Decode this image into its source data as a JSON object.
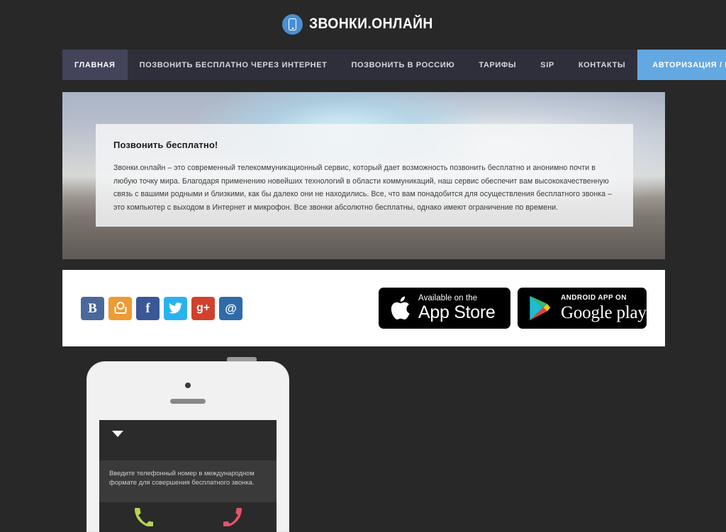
{
  "site": {
    "logo_text": "ЗВОНКИ.ОНЛАЙН",
    "logo_icon": "mobile-phone-icon",
    "accent_blue": "#63a8e0",
    "logo_blue": "#4a8fd1",
    "page_background": "#282828",
    "nav_background": "#2f2f3b",
    "nav_active_background": "#43435a"
  },
  "nav": {
    "items": [
      {
        "label": "ГЛАВНАЯ",
        "active": true
      },
      {
        "label": "ПОЗВОНИТЬ БЕСПЛАТНО ЧЕРЕЗ ИНТЕРНЕТ",
        "active": false
      },
      {
        "label": "ПОЗВОНИТЬ В РОССИЮ",
        "active": false
      },
      {
        "label": "ТАРИФЫ",
        "active": false
      },
      {
        "label": "SIP",
        "active": false
      },
      {
        "label": "КОНТАКТЫ",
        "active": false
      }
    ],
    "cta_label": "АВТОРИЗАЦИЯ / РЕГИСТРАЦИЯ"
  },
  "hero": {
    "title": "Позвонить бесплатно!",
    "body": "Звонки.онлайн – это современный телекоммуникационный сервис, который дает возможность позвонить бесплатно и анонимно почти в любую точку мира. Благодаря применению новейших технологий в области коммуникаций, наш сервис обеспечит вам высококачественную связь с вашими родными и близкими, как бы далеко они не находились. Все, что вам понадобится для осуществления бесплатного звонка – это компьютер с выходом в Интернет и микрофон. Все звонки абсолютно бесплатны, однако имеют ограничение по времени."
  },
  "social": {
    "items": [
      {
        "name": "vk",
        "glyph": "В",
        "color": "#4a699a"
      },
      {
        "name": "odnoklassniki",
        "glyph": "",
        "color": "#ed9b33"
      },
      {
        "name": "facebook",
        "glyph": "f",
        "color": "#3a5897"
      },
      {
        "name": "twitter",
        "glyph": "🐦",
        "color": "#2ab2ef"
      },
      {
        "name": "google-plus",
        "glyph": "g+",
        "color": "#d1412c"
      },
      {
        "name": "mail",
        "glyph": "@",
        "color": "#2f6ba8"
      }
    ]
  },
  "stores": {
    "appstore": {
      "small": "Available on the",
      "big": "App Store",
      "icon": "apple-logo-icon"
    },
    "google": {
      "small": "ANDROID APP ON",
      "big": "Google play",
      "icon": "google-play-triangle-icon"
    }
  },
  "phone_mockup": {
    "dropdown_icon": "caret-down-icon",
    "hint_text": "Введите телефонный номер в международном формате для совершения бесплатного звонка.",
    "call_button_icon": "phone-handset-green-icon",
    "hangup_button_icon": "phone-handset-red-icon",
    "call_color": "#b6d455",
    "hangup_color": "#e0566a"
  }
}
